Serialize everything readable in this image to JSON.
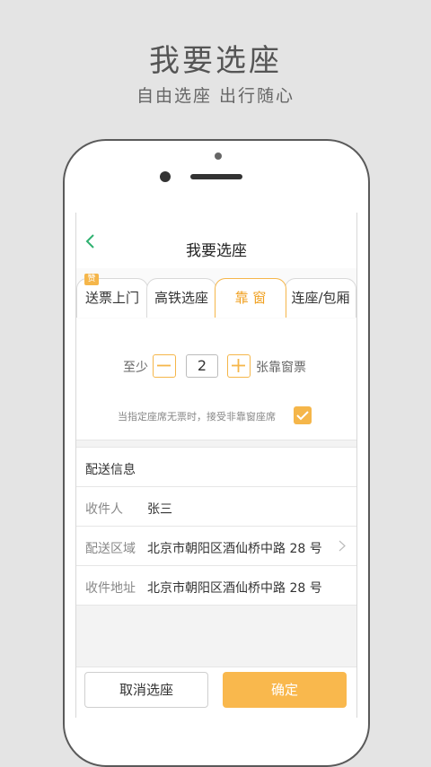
{
  "promo": {
    "title": "我要选座",
    "subtitle": "自由选座 出行随心"
  },
  "navbar": {
    "title": "我要选座",
    "back_icon": "chevron-left-icon"
  },
  "tabs": [
    {
      "label": "送票上门",
      "badge": "赞"
    },
    {
      "label": "高铁选座"
    },
    {
      "label": "靠 窗"
    },
    {
      "label": "连座/包厢"
    }
  ],
  "seat": {
    "prefix": "至少",
    "count": "2",
    "suffix": "张靠窗票",
    "accept_text": "当指定座席无票时，接受非靠窗座席",
    "accept_checked": true
  },
  "delivery": {
    "header": "配送信息",
    "rows": [
      {
        "label": "收件人",
        "value": "张三"
      },
      {
        "label": "配送区域",
        "value": "北京市朝阳区酒仙桥中路 28 号"
      },
      {
        "label": "收件地址",
        "value": "北京市朝阳区酒仙桥中路 28 号"
      }
    ]
  },
  "actions": {
    "cancel": "取消选座",
    "confirm": "确定"
  },
  "colors": {
    "accent": "#f5b64a",
    "confirm_bg": "#f9b84d",
    "nav_back": "#2fb170"
  }
}
